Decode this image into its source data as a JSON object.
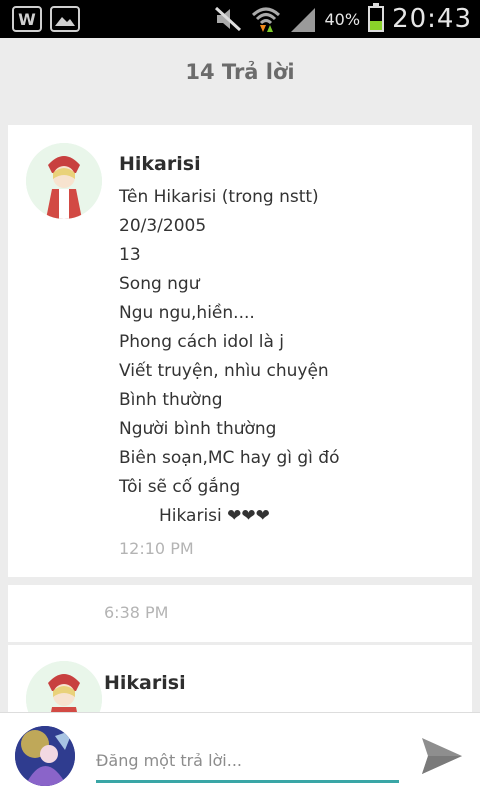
{
  "status_bar": {
    "battery_percent": "40%",
    "battery_level": 0.4,
    "time": "20:43",
    "icons": [
      "app-w-icon",
      "gallery-icon",
      "mute-icon",
      "wifi-icon",
      "signal-icon",
      "battery-icon"
    ]
  },
  "header": {
    "title": "14 Trả lời"
  },
  "comments": [
    {
      "author": "Hikarisi",
      "lines": [
        "Tên Hikarisi (trong nstt)",
        "20/3/2005",
        "13",
        "Song ngư",
        "Ngu ngu,hiền....",
        "Phong cách idol là j",
        "Viết truyện, nhìu chuyện",
        "Bình thường",
        "Người bình thường",
        "Biên soạn,MC hay gì gì đó",
        "Tôi sẽ cố gắng"
      ],
      "signature": "Hikarisi ❤❤❤",
      "time": "12:10 PM"
    },
    {
      "time": "6:38 PM"
    },
    {
      "author": "Hikarisi"
    }
  ],
  "reply": {
    "placeholder": "Đăng một trả lời..."
  },
  "colors": {
    "accent": "#3aa6a6",
    "status_bar": "#000000",
    "background": "#ececec"
  }
}
